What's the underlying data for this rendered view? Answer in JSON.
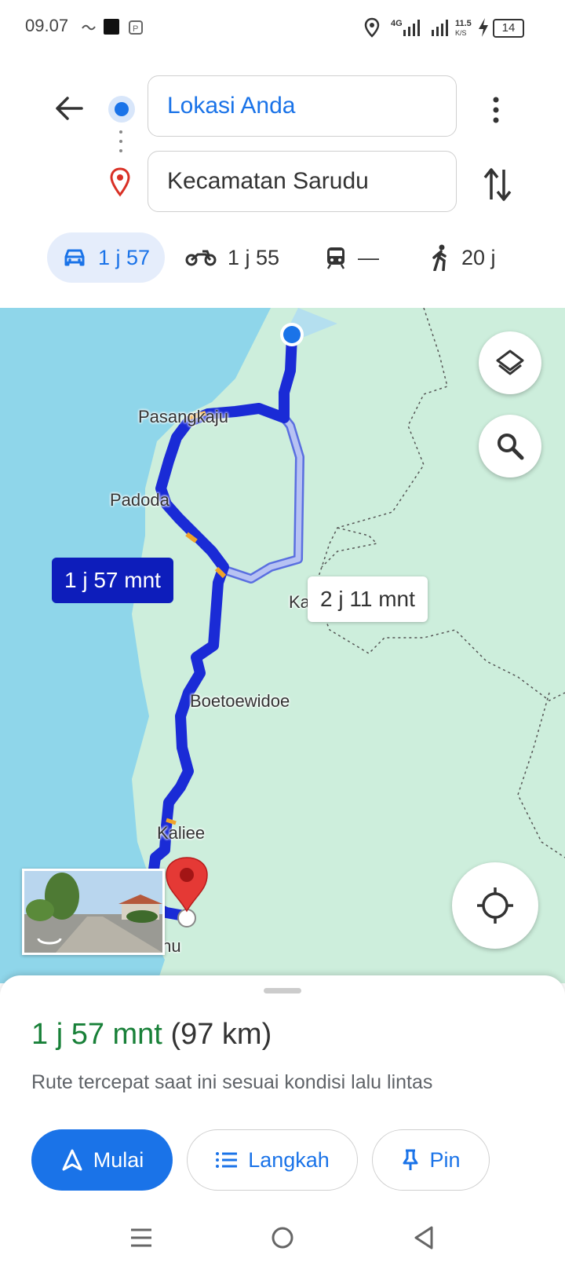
{
  "status_bar": {
    "time": "09.07",
    "network": "4G",
    "speed_top": "11.5",
    "speed_unit": "K/S",
    "battery": "14"
  },
  "header": {
    "origin": "Lokasi Anda",
    "destination": "Kecamatan Sarudu"
  },
  "modes": [
    {
      "name": "car",
      "label": "1 j 57"
    },
    {
      "name": "motorcycle",
      "label": "1 j 55"
    },
    {
      "name": "transit",
      "label": "—"
    },
    {
      "name": "walk",
      "label": "20 j"
    }
  ],
  "map": {
    "labels": {
      "pasangkaju": "Pasangkaju",
      "padoda": "Padoda",
      "kaleang": "Ka",
      "boetoewidoe": "Boetoewidoe",
      "kaliee": "Kaliee",
      "nunu": "Nunu"
    },
    "primary_time": "1 j 57 mnt",
    "alt_time": "2 j 11 mnt",
    "colors": {
      "water": "#8fd6ea",
      "land": "#cdeedc",
      "route": "#1a2bd6",
      "alt_route": "#a9b8f0",
      "traffic": "#f0a32a"
    }
  },
  "sheet": {
    "duration": "1 j 57 mnt",
    "distance": "(97 km)",
    "description": "Rute tercepat saat ini sesuai kondisi lalu lintas",
    "start_label": "Mulai",
    "steps_label": "Langkah",
    "pin_label": "Pin"
  }
}
